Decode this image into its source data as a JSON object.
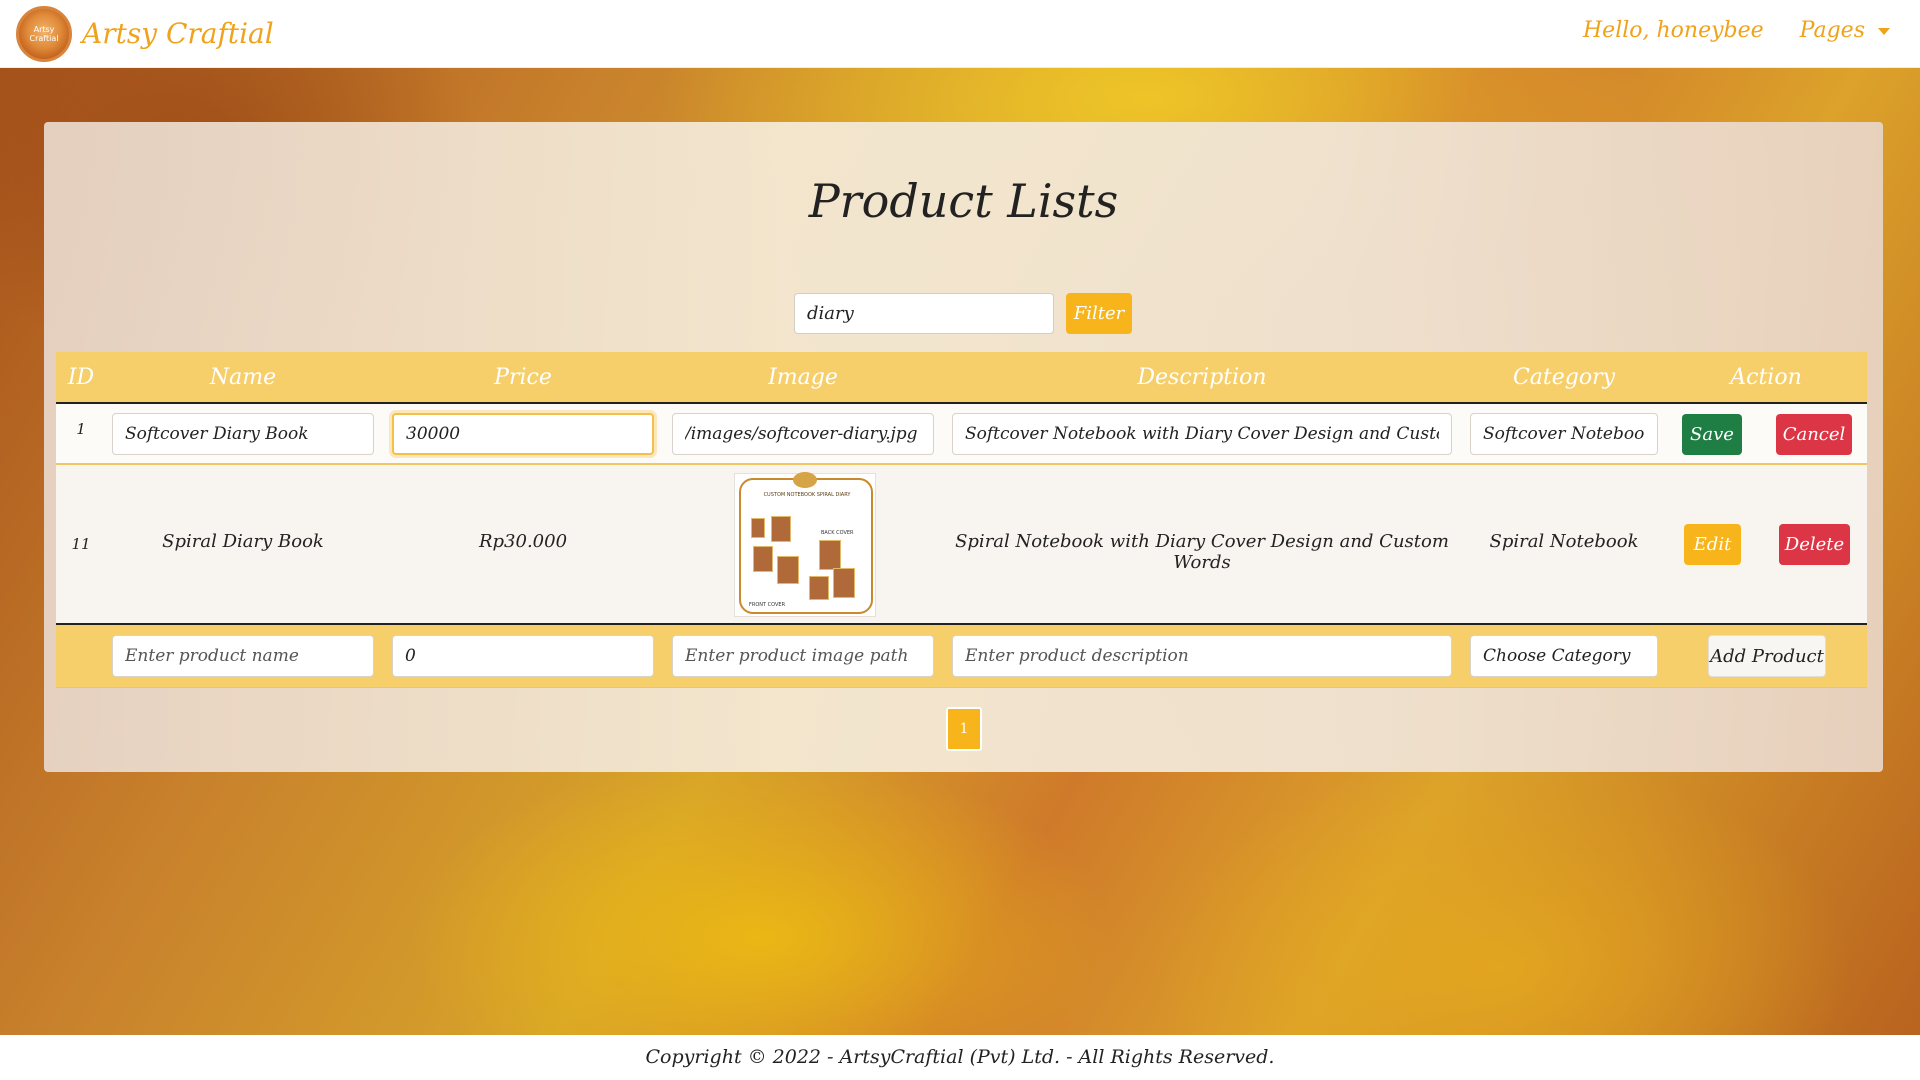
{
  "navbar": {
    "logo_text": "Artsy Craftial",
    "brand": "Artsy Craftial",
    "greeting": "Hello, honeybee",
    "pages_menu": "Pages"
  },
  "page": {
    "title": "Product Lists"
  },
  "filter": {
    "value": "diary",
    "button": "Filter"
  },
  "table": {
    "headers": [
      "ID",
      "Name",
      "Price",
      "Image",
      "Description",
      "Category",
      "Action"
    ],
    "editing_row": {
      "id": "1",
      "name": "Softcover Diary Book",
      "price": "30000",
      "image": "/images/softcover-diary.jpg",
      "description": "Softcover Notebook with Diary Cover Design and Custom Words",
      "category": "Softcover Notebook",
      "save": "Save",
      "cancel": "Cancel"
    },
    "rows": [
      {
        "id": "11",
        "name": "Spiral Diary Book",
        "price": "Rp30.000",
        "image_text": "CUSTOM NOTEBOOK SPIRAL DIARY",
        "image_back": "BACK COVER",
        "image_front": "FRONT COVER",
        "description": "Spiral Notebook with Diary Cover Design and Custom Words",
        "category": "Spiral Notebook",
        "edit": "Edit",
        "delete": "Delete"
      }
    ],
    "add_row": {
      "name_placeholder": "Enter product name",
      "price_value": "0",
      "image_placeholder": "Enter product image path",
      "description_placeholder": "Enter product description",
      "category": "Choose Category",
      "add_button": "Add Product"
    }
  },
  "pagination": {
    "current": "1"
  },
  "footer": {
    "copyright": "Copyright © 2022 - ArtsyCraftial (Pvt) Ltd. - All Rights Reserved."
  }
}
